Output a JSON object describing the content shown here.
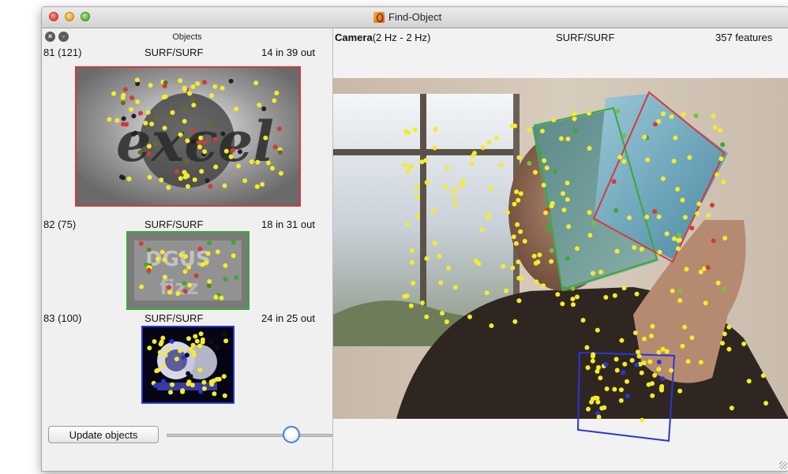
{
  "window": {
    "title": "Find-Object"
  },
  "objects_panel": {
    "title": "Objects",
    "objects": [
      {
        "id": "81 (121)",
        "detector": "SURF/SURF",
        "matches": "14 in 39 out"
      },
      {
        "id": "82 (75)",
        "detector": "SURF/SURF",
        "matches": "18 in 31 out"
      },
      {
        "id": "83 (100)",
        "detector": "SURF/SURF",
        "matches": "24 in 25 out"
      }
    ],
    "update_button": "Update objects",
    "slider_level": 0.75
  },
  "camera_panel": {
    "title": "Camera",
    "rate": "(2 Hz - 2 Hz)",
    "detector": "SURF/SURF",
    "features": "357 features"
  },
  "colors": {
    "feature_point": "#f3ec2a",
    "object_81_box": "#d23a3a",
    "object_82_box": "#3aa83a",
    "object_83_box": "#2b35d8"
  },
  "icons": {
    "panel_close": "close-circle-icon",
    "panel_float": "float-circle-icon",
    "app": "find-object-app-icon"
  }
}
